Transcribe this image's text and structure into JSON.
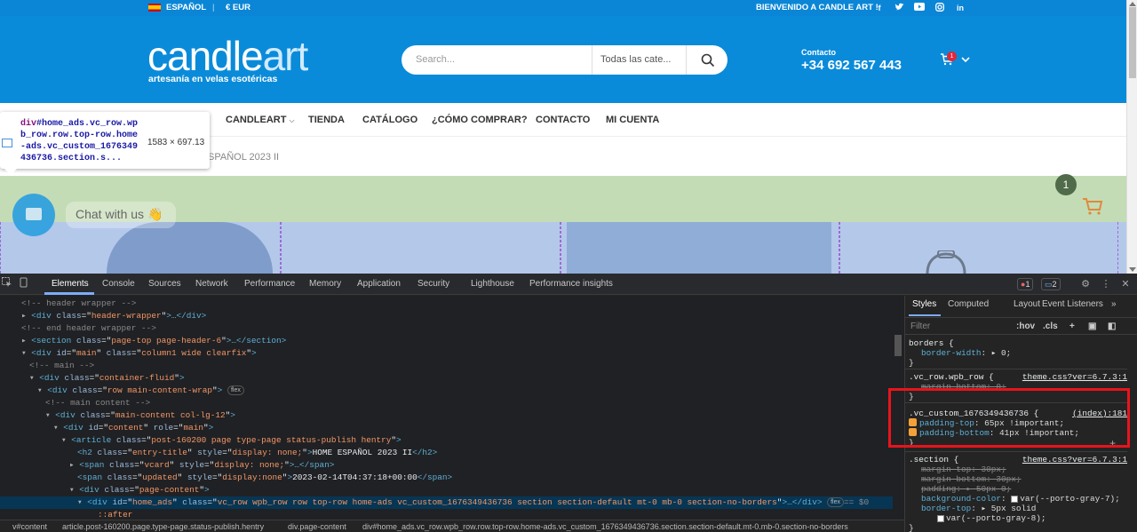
{
  "site": {
    "topbar": {
      "language": "ESPAÑOL",
      "divider": "|",
      "currency": "€ EUR",
      "welcome": "BIENVENIDO A CANDLE ART !",
      "social": [
        "facebook-icon",
        "twitter-icon",
        "youtube-icon",
        "instagram-icon",
        "linkedin-icon"
      ]
    },
    "logo": {
      "main": "candle",
      "accent": "art",
      "tagline": "artesanía en velas esotéricas"
    },
    "search": {
      "placeholder": "Search...",
      "category": "Todas las cate..."
    },
    "contact": {
      "label": "Contacto",
      "phone": "+34 692 567 443"
    },
    "cart_count": "1",
    "nav": [
      "CANDLEART",
      "TIENDA",
      "CATÁLOGO",
      "¿CÓMO COMPRAR?",
      "CONTACTO",
      "MI CUENTA"
    ],
    "breadcrumb": "SPAÑOL 2023 II",
    "chat_label": "Chat with us",
    "chat_emoji": "👋",
    "floating_cart_count": "1"
  },
  "inspect_tooltip": {
    "selector_tag": "div",
    "selector_rest": "#home_ads.vc_row.wpb_row.row.top-row.home-ads.vc_custom_1676349436736.section.s...",
    "dimensions": "1583 × 697.13"
  },
  "devtools": {
    "tabs": [
      "Elements",
      "Console",
      "Sources",
      "Network",
      "Performance",
      "Memory",
      "Application",
      "Security",
      "Lighthouse",
      "Performance insights"
    ],
    "active_tab": "Elements",
    "error_count": "1",
    "message_count": "2",
    "dom_lines": [
      {
        "indent": 0,
        "kind": "comment",
        "text": "<!-- header wrapper -->"
      },
      {
        "indent": 0,
        "kind": "closed",
        "tag": "div",
        "attrs": [
          [
            "class",
            "header-wrapper"
          ]
        ],
        "tail": "…</div>"
      },
      {
        "indent": 0,
        "kind": "comment",
        "text": "<!-- end header wrapper -->"
      },
      {
        "indent": 0,
        "kind": "closed",
        "tag": "section",
        "attrs": [
          [
            "class",
            "page-top page-header-6"
          ]
        ],
        "tail": "…</section>"
      },
      {
        "indent": 0,
        "kind": "open",
        "tag": "div",
        "attrs": [
          [
            "id",
            "main"
          ],
          [
            "class",
            "column1 wide clearfix"
          ]
        ]
      },
      {
        "indent": 1,
        "kind": "comment",
        "text": "<!-- main -->"
      },
      {
        "indent": 1,
        "kind": "open",
        "tag": "div",
        "attrs": [
          [
            "class",
            "container-fluid"
          ]
        ]
      },
      {
        "indent": 2,
        "kind": "open",
        "tag": "div",
        "attrs": [
          [
            "class",
            "row main-content-wrap"
          ]
        ],
        "badge": "flex"
      },
      {
        "indent": 3,
        "kind": "comment",
        "text": "<!-- main content -->"
      },
      {
        "indent": 3,
        "kind": "open",
        "tag": "div",
        "attrs": [
          [
            "class",
            "main-content col-lg-12"
          ]
        ]
      },
      {
        "indent": 4,
        "kind": "open",
        "tag": "div",
        "attrs": [
          [
            "id",
            "content"
          ],
          [
            "role",
            "main"
          ]
        ]
      },
      {
        "indent": 5,
        "kind": "open",
        "tag": "article",
        "attrs": [
          [
            "class",
            "post-160200 page type-page status-publish hentry"
          ]
        ]
      },
      {
        "indent": 6,
        "kind": "inline",
        "tag": "h2",
        "attrs": [
          [
            "class",
            "entry-title"
          ],
          [
            "style",
            "display: none;"
          ]
        ],
        "content": "HOME ESPAÑOL 2023 II",
        "close": "</h2>"
      },
      {
        "indent": 6,
        "kind": "closed",
        "tag": "span",
        "attrs": [
          [
            "class",
            "vcard"
          ],
          [
            "style",
            "display: none;"
          ]
        ],
        "tail": "…</span>"
      },
      {
        "indent": 6,
        "kind": "inline",
        "tag": "span",
        "attrs": [
          [
            "class",
            "updated"
          ],
          [
            "style",
            "display:none"
          ]
        ],
        "content": "2023-02-14T04:37:18+00:00",
        "close": "</span>"
      },
      {
        "indent": 6,
        "kind": "open",
        "tag": "div",
        "attrs": [
          [
            "class",
            "page-content"
          ]
        ]
      },
      {
        "indent": 7,
        "kind": "selected",
        "tag": "div",
        "attrs": [
          [
            "id",
            "home_ads"
          ],
          [
            "class",
            "vc_row wpb_row row top-row home-ads vc_custom_1676349436736 section section-default mt-0 mb-0 section-no-borders"
          ]
        ],
        "tail": "…</div>",
        "badge": "flex",
        "eq": "== $0"
      },
      {
        "indent": 8,
        "kind": "pseudo",
        "text": "::after"
      }
    ],
    "breadcrumbs": [
      "v#content",
      "article.post-160200.page.type-page.status-publish.hentry",
      "div.page-content",
      "div#home_ads.vc_row.wpb_row.row.top-row.home-ads.vc_custom_1676349436736.section.section-default.mt-0.mb-0.section-no-borders"
    ],
    "styles_tabs": [
      "Styles",
      "Computed",
      "Layout",
      "Event Listeners"
    ],
    "filter_placeholder": "Filter",
    "filter_hov": ":hov",
    "filter_cls": ".cls",
    "rules": {
      "r0": {
        "selector": "borders {",
        "prop": "border-width",
        "val": "0;",
        "close": "}"
      },
      "r1": {
        "selector": ".vc_row.wpb_row {",
        "source": "theme.css?ver=6.7.3:1",
        "prop": "margin-bottom",
        "val": "0;",
        "close": "}"
      },
      "r2": {
        "selector": ".vc_custom_1676349436736 {",
        "source": "(index):181",
        "p1": "padding-top",
        "v1": "65px !important;",
        "p2": "padding-bottom",
        "v2": "41px !important;",
        "close": "}"
      },
      "r3": {
        "selector": ".section {",
        "source": "theme.css?ver=6.7.3:1",
        "p1": "margin-top",
        "v1": "30px;",
        "p2": "margin-bottom",
        "v2": "30px;",
        "p3": "padding",
        "v3": "50px 0;",
        "p4": "background-color",
        "v4": "var(--porto-gray-7);",
        "p5": "border-top",
        "v5": "5px solid",
        "v6": "var(--porto-gray-8);",
        "close": "}"
      }
    }
  }
}
